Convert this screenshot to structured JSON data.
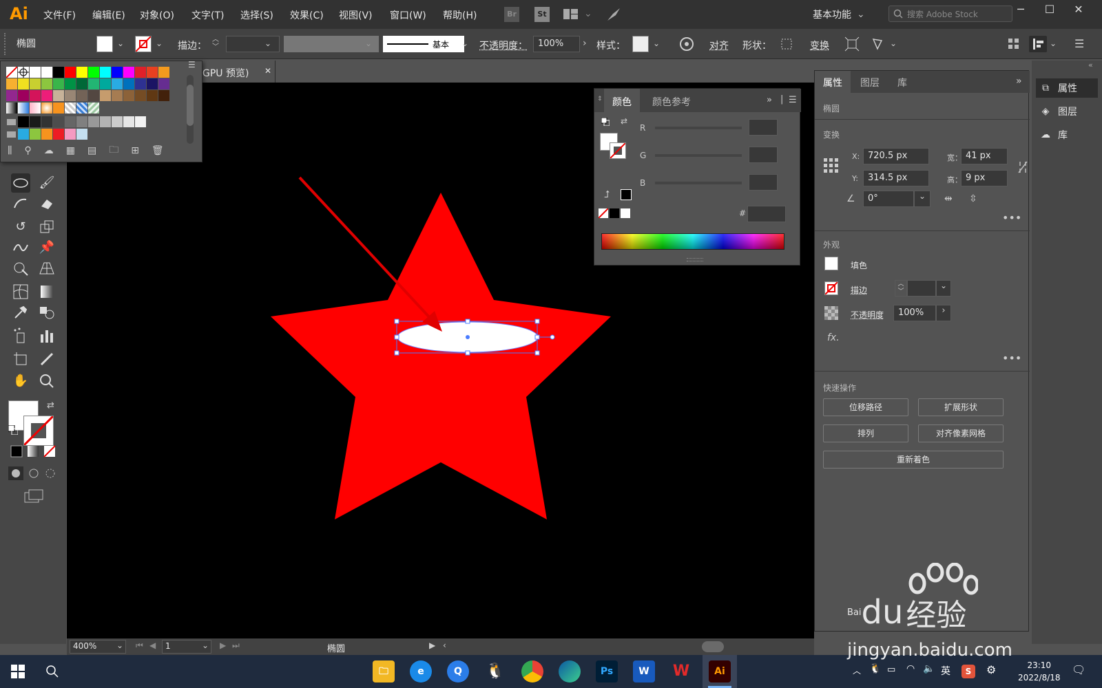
{
  "app": {
    "logo": "Ai",
    "menu": [
      "文件(F)",
      "编辑(E)",
      "对象(O)",
      "文字(T)",
      "选择(S)",
      "效果(C)",
      "视图(V)",
      "窗口(W)",
      "帮助(H)"
    ],
    "bridge_label": "Br",
    "stock_label": "St",
    "workspace": "基本功能",
    "search_placeholder": "搜索 Adobe Stock"
  },
  "controlbar": {
    "object_type": "椭圆",
    "stroke_label": "描边：",
    "stroke_profile": "基本",
    "opacity_label": "不透明度：",
    "opacity_value": "100%",
    "style_label": "样式：",
    "align_label": "对齐",
    "shape_label": "形状：",
    "transform_label": "变换"
  },
  "document": {
    "tab_title": "GPU 预览)",
    "zoom": "400%",
    "artboard": "1",
    "status_text": "椭圆"
  },
  "color_panel": {
    "tab_color": "颜色",
    "tab_guide": "颜色参考",
    "channels": [
      "R",
      "G",
      "B"
    ],
    "hex_label": "#"
  },
  "properties": {
    "tabs": [
      "属性",
      "图层",
      "库"
    ],
    "object_name": "椭圆",
    "transform_title": "变换",
    "x_label": "X:",
    "x_value": "720.5 px",
    "y_label": "Y:",
    "y_value": "314.5 px",
    "w_label": "宽：",
    "w_value": "41 px",
    "h_label": "高：",
    "h_value": "9 px",
    "angle_value": "0°",
    "appearance_title": "外观",
    "fill_label": "填色",
    "stroke_label": "描边",
    "opacity_label": "不透明度",
    "opacity_value": "100%",
    "fx_label": "fx.",
    "quick_title": "快速操作",
    "btn_offset_path": "位移路径",
    "btn_expand_shape": "扩展形状",
    "btn_arrange": "排列",
    "btn_align_pixel": "对齐像素网格",
    "btn_recolor": "重新着色"
  },
  "dock": {
    "items": [
      "属性",
      "图层",
      "库"
    ]
  },
  "taskbar": {
    "ps_label": "Ps",
    "word_label": "W",
    "ai_label": "Ai",
    "ime": "英",
    "time": "23:10",
    "date": "2022/8/18"
  },
  "watermark": {
    "brand": "Bai",
    "brand_du": "du",
    "brand_cn": "经验",
    "url": "jingyan.baidu.com"
  },
  "colors": {
    "star": "#ff0000",
    "arrow": "#e00000",
    "selection": "#4a7cff",
    "ai_orange": "#ff9a00"
  }
}
